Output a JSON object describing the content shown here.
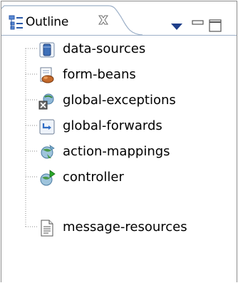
{
  "view": {
    "tab_label": "Outline",
    "tab_icon": "outline-view-icon",
    "close_icon": "close-icon",
    "menu_icon": "view-menu-chevron-down-icon",
    "minimize_icon": "minimize-icon",
    "maximize_icon": "maximize-icon"
  },
  "tree": {
    "items": [
      {
        "label": "data-sources",
        "icon": "data-source-icon"
      },
      {
        "label": "form-beans",
        "icon": "form-bean-icon"
      },
      {
        "label": "global-exceptions",
        "icon": "global-exception-icon"
      },
      {
        "label": "global-forwards",
        "icon": "global-forward-icon"
      },
      {
        "label": "action-mappings",
        "icon": "action-mapping-icon"
      },
      {
        "label": "controller",
        "icon": "controller-icon"
      },
      {
        "label": "message-resources",
        "icon": "message-resource-icon"
      }
    ]
  },
  "colors": {
    "frame_border": "#8d8d8d",
    "tab_border": "#9db0c8",
    "tree_lines": "#8c8c8c"
  }
}
